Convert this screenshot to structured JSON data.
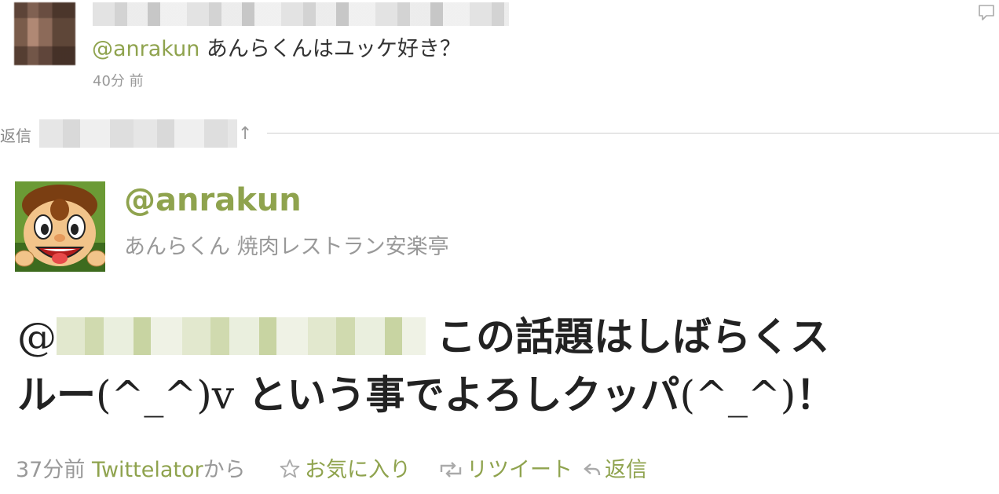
{
  "parent_tweet": {
    "text_mention": "@anrakun",
    "text_body": " あんらくんはユッケ好き？",
    "time": "40分 前"
  },
  "reply_link": {
    "label": "返信",
    "arrow": "↑"
  },
  "main_tweet": {
    "username": "@anrakun",
    "fullname": "あんらくん 焼肉レストラン安楽亭",
    "body_at": "@",
    "body_line1": "この話題はしばらくス",
    "body_line2_a": "ルー",
    "body_line2_b": "(^_^)v",
    "body_line2_c": " という事でよろしクッパ",
    "body_line2_d": "(^_^)",
    "body_line2_e": "！",
    "time": "37分前",
    "client": "Twittelator",
    "client_suffix": "から"
  },
  "actions": {
    "favorite": "お気に入り",
    "retweet": "リツイート",
    "reply": "返信"
  },
  "colors": {
    "accent": "#8fa34e",
    "muted": "#999999",
    "text": "#222222"
  },
  "icons": {
    "comment": "comment-icon",
    "favorite": "star-icon",
    "retweet": "retweet-icon",
    "reply": "reply-arrow-icon"
  }
}
